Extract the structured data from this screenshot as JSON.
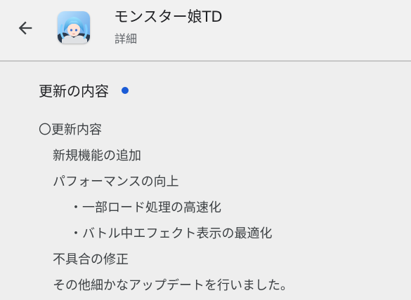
{
  "header": {
    "back_icon": "arrow-left-icon",
    "app_icon": "app-icon-anime-girl",
    "title": "モンスター娘TD",
    "subtitle": "詳細"
  },
  "section": {
    "title": "更新の内容",
    "new_indicator_color": "#1a5bd6"
  },
  "release_notes": [
    "〇更新内容",
    "新規機能の追加",
    "パフォーマンスの向上",
    "・一部ロード処理の高速化",
    "・バトル中エフェクト表示の最適化",
    "不具合の修正",
    "その他細かなアップデートを行いました。"
  ],
  "colors": {
    "background": "#eeeeee",
    "divider": "#c6c6c6",
    "accent": "#1a5bd6"
  }
}
